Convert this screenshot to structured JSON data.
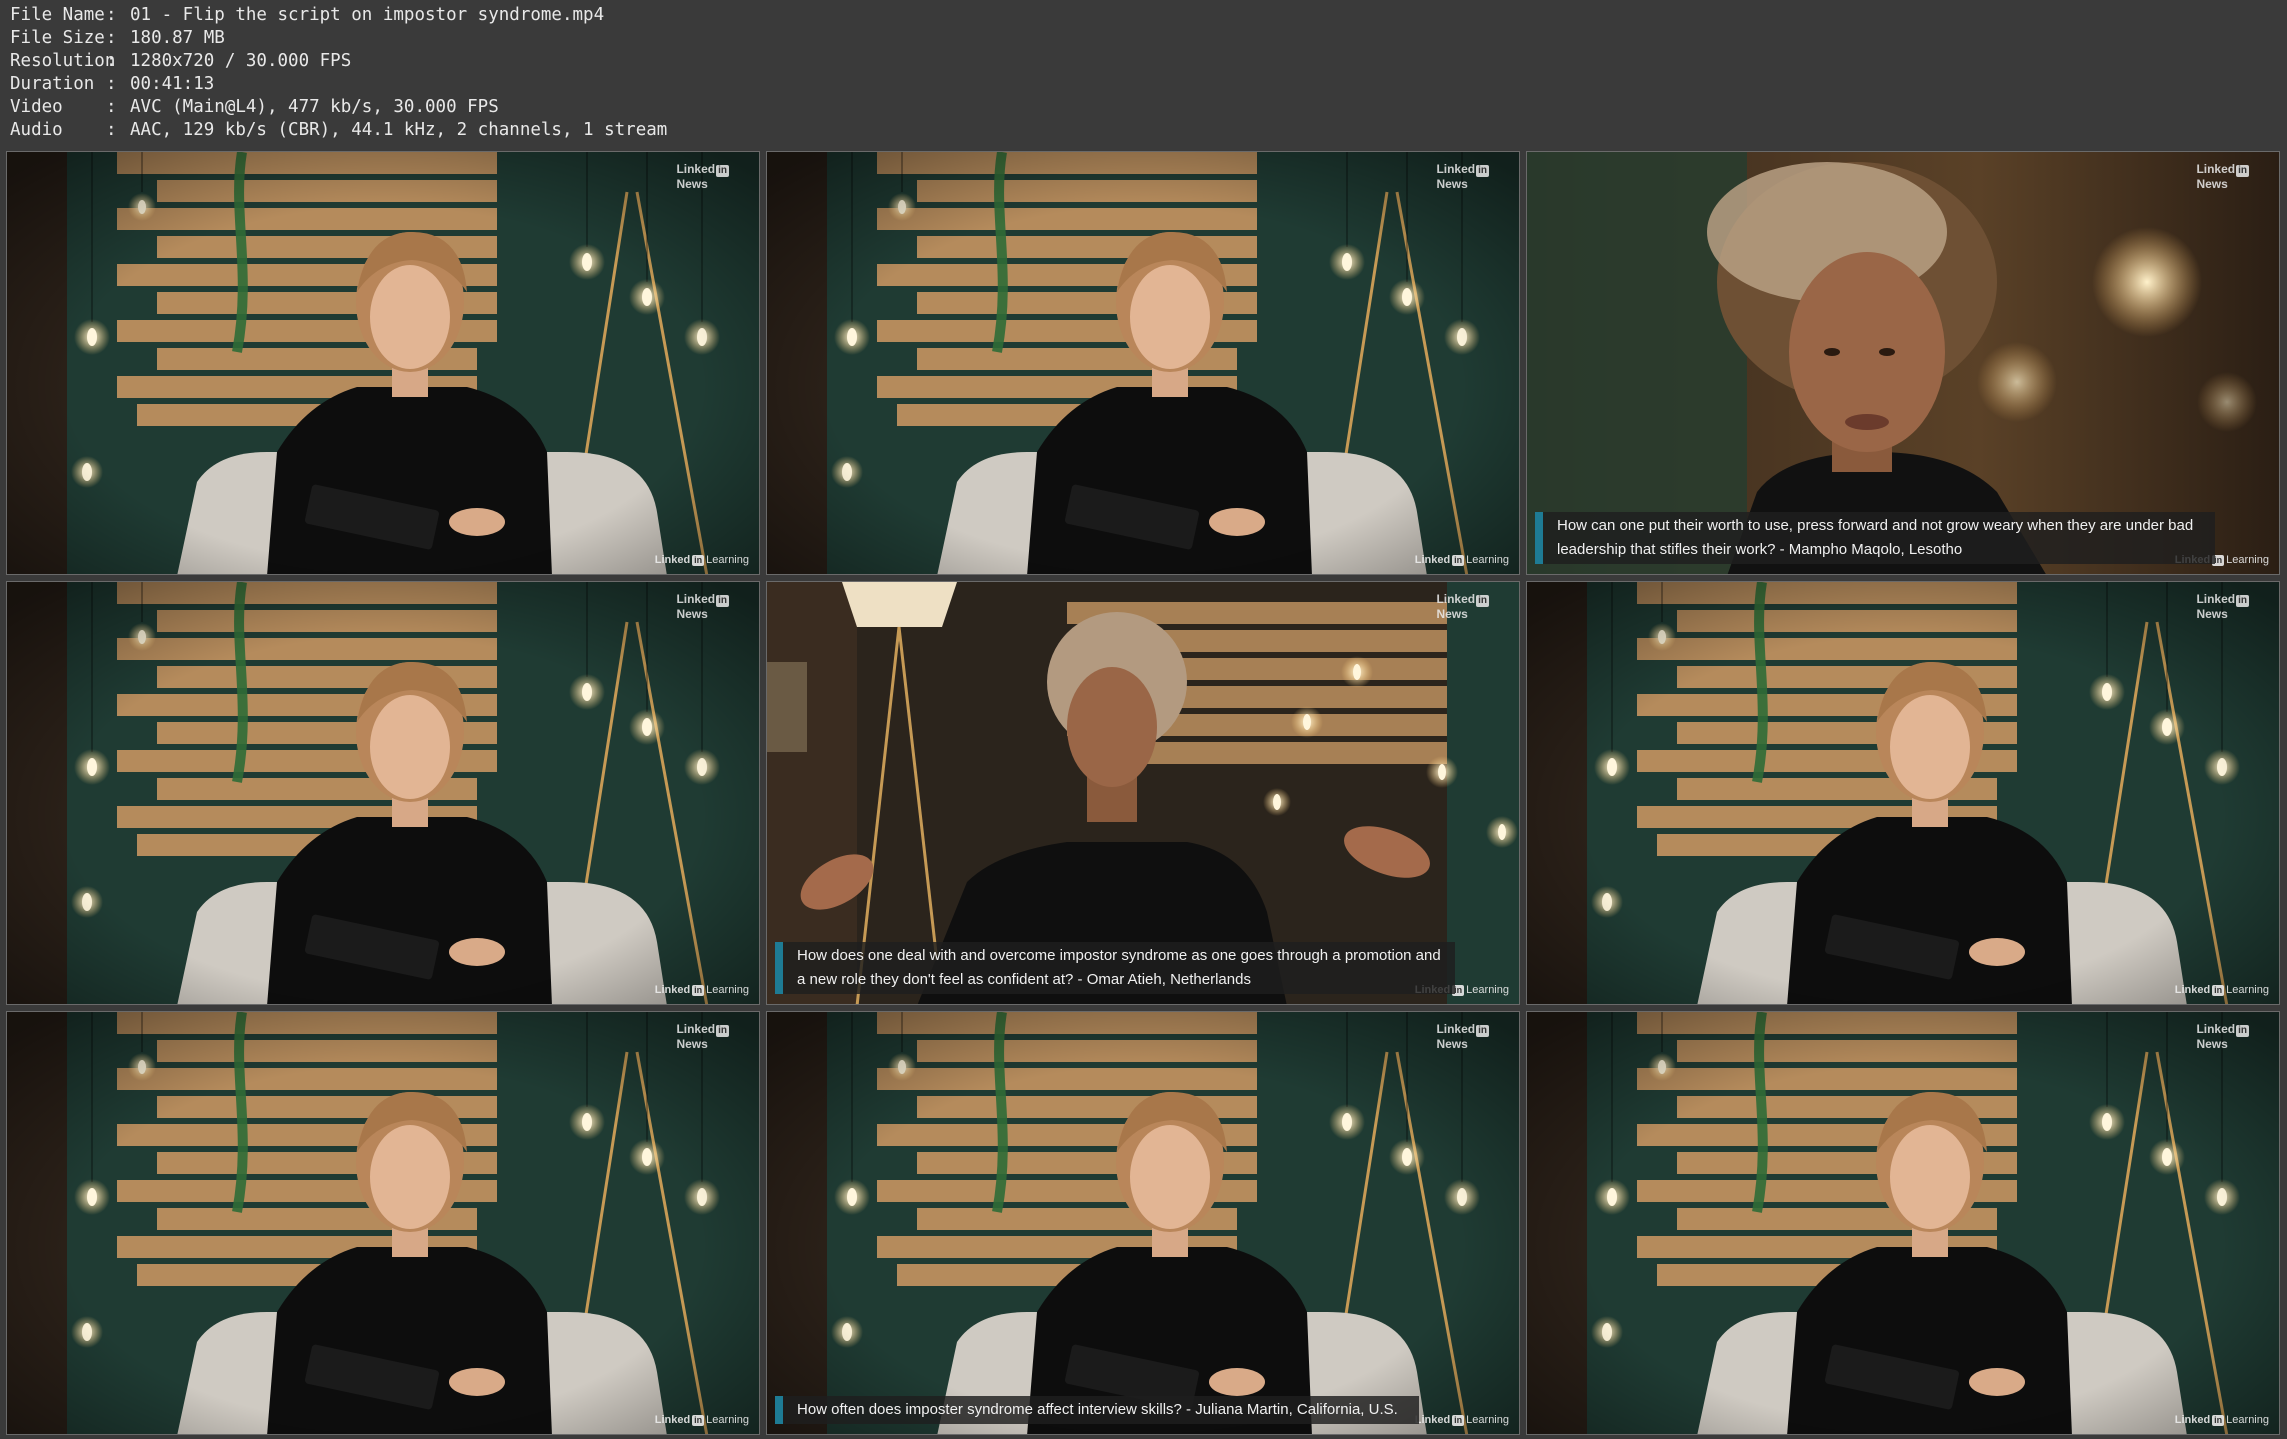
{
  "meta": [
    {
      "key": "File Name",
      "value": "01 - Flip the script on impostor syndrome.mp4"
    },
    {
      "key": "File Size",
      "value": "180.87 MB"
    },
    {
      "key": "Resolution",
      "value": "1280x720 / 30.000 FPS"
    },
    {
      "key": "Duration",
      "value": "00:41:13"
    },
    {
      "key": "Video",
      "value": "AVC (Main@L4), 477 kb/s, 30.000 FPS"
    },
    {
      "key": "Audio",
      "value": "AAC, 129 kb/s (CBR), 44.1 kHz, 2 channels, 1 stream"
    }
  ],
  "meta_separator": ":",
  "badges": {
    "news_linked": "Linked",
    "news_in": "in",
    "news_word": "News",
    "learning_linked": "Linked",
    "learning_in": "in",
    "learning_word": "Learning"
  },
  "colors": {
    "caption_accent": "#1e7b94",
    "wall_green": "#1f3b33",
    "wood": "#b58b5c",
    "background": "#3a3a3a"
  },
  "frames": [
    {
      "scene": "host",
      "caption": ""
    },
    {
      "scene": "host",
      "caption": ""
    },
    {
      "scene": "guest-close",
      "caption": "How can one put their worth to use, press forward and not grow weary when they are under bad leadership that stifles their work? - Mampho Maqolo, Lesotho"
    },
    {
      "scene": "host",
      "caption": ""
    },
    {
      "scene": "guest-wide",
      "caption": "How does one deal with and overcome impostor syndrome as one goes through a promotion and a new role they don't feel as confident at? - Omar Atieh, Netherlands"
    },
    {
      "scene": "host",
      "caption": ""
    },
    {
      "scene": "host",
      "caption": ""
    },
    {
      "scene": "host",
      "caption": "How often does imposter syndrome affect interview skills? - Juliana Martin, California, U.S."
    },
    {
      "scene": "host",
      "caption": ""
    }
  ]
}
